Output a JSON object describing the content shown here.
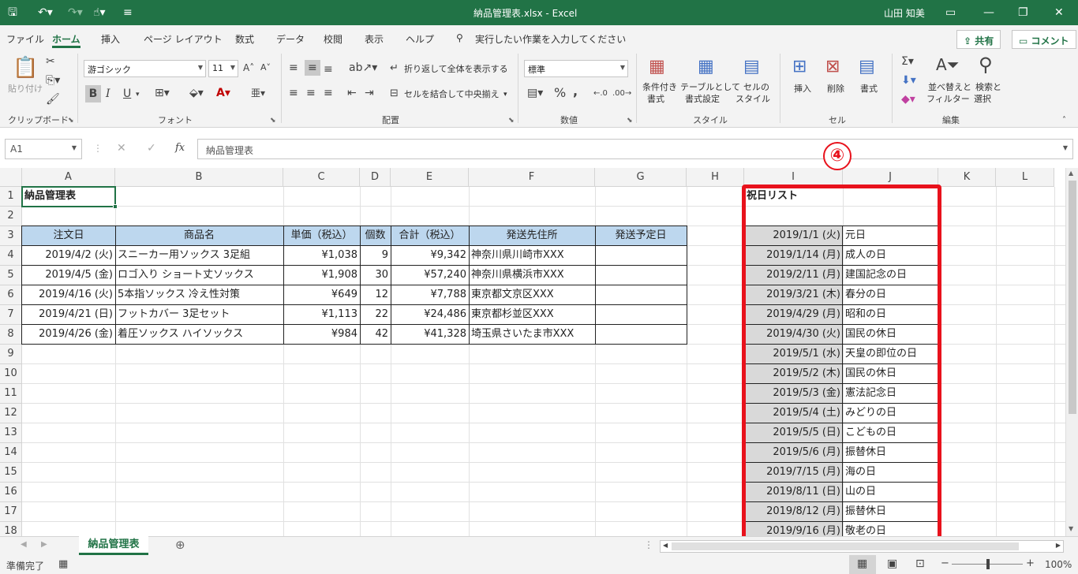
{
  "window": {
    "title": "納品管理表.xlsx - Excel",
    "user": "山田 知美"
  },
  "menu": [
    "ファイル",
    "ホーム",
    "挿入",
    "ページ レイアウト",
    "数式",
    "データ",
    "校閲",
    "表示",
    "ヘルプ"
  ],
  "search_placeholder": "実行したい作業を入力してください",
  "share_label": "共有",
  "comment_label": "コメント",
  "ribbon": {
    "clipboard": {
      "group": "クリップボード",
      "paste": "貼り付け"
    },
    "font": {
      "group": "フォント",
      "font_name": "游ゴシック",
      "font_size": "11",
      "bold": "B",
      "italic": "I",
      "underline": "U"
    },
    "alignment": {
      "group": "配置",
      "wrap": "折り返して全体を表示する",
      "merge": "セルを結合して中央揃え"
    },
    "number": {
      "group": "数値",
      "format": "標準"
    },
    "styles": {
      "group": "スタイル",
      "conditional": [
        "条件付き",
        "書式"
      ],
      "table": [
        "テーブルとして",
        "書式設定"
      ],
      "cell_styles": [
        "セルの",
        "スタイル"
      ]
    },
    "cells": {
      "group": "セル",
      "insert": "挿入",
      "delete": "削除",
      "format": "書式"
    },
    "editing": {
      "group": "編集",
      "sort": [
        "並べ替えと",
        "フィルター"
      ],
      "find": [
        "検索と",
        "選択"
      ]
    }
  },
  "namebox": "A1",
  "formula": "納品管理表",
  "columns": [
    "A",
    "B",
    "C",
    "D",
    "E",
    "F",
    "G",
    "H",
    "I",
    "J",
    "K",
    "L"
  ],
  "rows": [
    "1",
    "2",
    "3",
    "4",
    "5",
    "6",
    "7",
    "8",
    "9",
    "10",
    "11",
    "12",
    "13",
    "14",
    "15",
    "16",
    "17",
    "18"
  ],
  "table": {
    "title": "納品管理表",
    "headers": [
      "注文日",
      "商品名",
      "単価（税込）",
      "個数",
      "合計（税込）",
      "発送先住所",
      "発送予定日"
    ],
    "rows": [
      [
        "2019/4/2 (火)",
        "スニーカー用ソックス 3足組",
        "¥1,038",
        "9",
        "¥9,342",
        "神奈川県川崎市XXX",
        ""
      ],
      [
        "2019/4/5 (金)",
        "ロゴ入り ショート丈ソックス",
        "¥1,908",
        "30",
        "¥57,240",
        "神奈川県横浜市XXX",
        ""
      ],
      [
        "2019/4/16 (火)",
        "5本指ソックス 冷え性対策",
        "¥649",
        "12",
        "¥7,788",
        "東京都文京区XXX",
        ""
      ],
      [
        "2019/4/21 (日)",
        "フットカバー 3足セット",
        "¥1,113",
        "22",
        "¥24,486",
        "東京都杉並区XXX",
        ""
      ],
      [
        "2019/4/26 (金)",
        "着圧ソックス ハイソックス",
        "¥984",
        "42",
        "¥41,328",
        "埼玉県さいたま市XXX",
        ""
      ]
    ]
  },
  "holidays": {
    "title": "祝日リスト",
    "rows": [
      [
        "2019/1/1 (火)",
        "元日"
      ],
      [
        "2019/1/14 (月)",
        "成人の日"
      ],
      [
        "2019/2/11 (月)",
        "建国記念の日"
      ],
      [
        "2019/3/21 (木)",
        "春分の日"
      ],
      [
        "2019/4/29 (月)",
        "昭和の日"
      ],
      [
        "2019/4/30 (火)",
        "国民の休日"
      ],
      [
        "2019/5/1 (水)",
        "天皇の即位の日"
      ],
      [
        "2019/5/2 (木)",
        "国民の休日"
      ],
      [
        "2019/5/3 (金)",
        "憲法記念日"
      ],
      [
        "2019/5/4 (土)",
        "みどりの日"
      ],
      [
        "2019/5/5 (日)",
        "こどもの日"
      ],
      [
        "2019/5/6 (月)",
        "振替休日"
      ],
      [
        "2019/7/15 (月)",
        "海の日"
      ],
      [
        "2019/8/11 (日)",
        "山の日"
      ],
      [
        "2019/8/12 (月)",
        "振替休日"
      ],
      [
        "2019/9/16 (月)",
        "敬老の日"
      ]
    ]
  },
  "annotation": "④",
  "sheet_tab": "納品管理表",
  "status": {
    "ready": "準備完了",
    "zoom": "100%"
  },
  "colors": {
    "excel_green": "#217346",
    "header_fill": "#bdd7ee",
    "highlight_red": "#e8121c"
  }
}
